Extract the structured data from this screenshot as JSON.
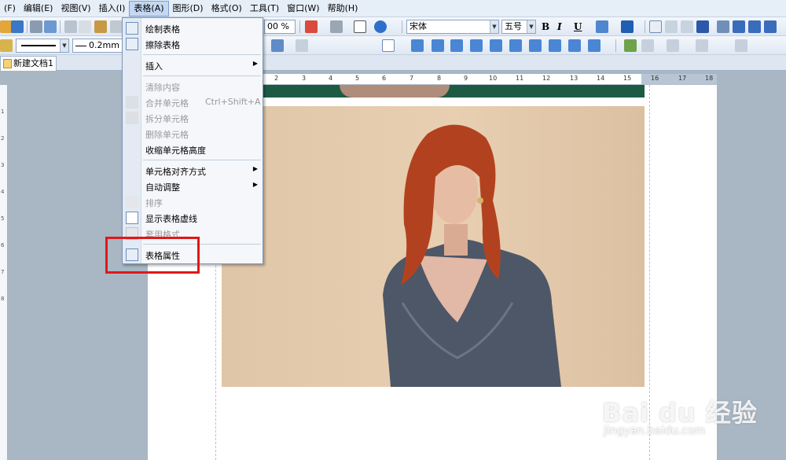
{
  "menubar": {
    "items": [
      "(F)",
      "编辑(E)",
      "视图(V)",
      "插入(I)",
      "表格(A)",
      "图形(D)",
      "格式(O)",
      "工具(T)",
      "窗口(W)",
      "帮助(H)"
    ],
    "active_index": 4
  },
  "toolbar": {
    "zoom": "00 %",
    "font_name": "宋体",
    "font_size": "五号",
    "bold": "B",
    "italic": "I",
    "underline": "U",
    "line_width": "0.2mm"
  },
  "tabs": {
    "document": "新建文档1"
  },
  "ruler": {
    "numbers": [
      "2",
      "3",
      "4",
      "5",
      "6",
      "7",
      "8",
      "9",
      "10",
      "11",
      "12",
      "13",
      "14",
      "15",
      "16",
      "17",
      "18"
    ],
    "vertical_numbers": [
      "1",
      "2",
      "3",
      "4",
      "5",
      "6",
      "7",
      "8"
    ]
  },
  "table_menu": {
    "draw_table": "绘制表格",
    "erase_table": "擦除表格",
    "insert": "插入",
    "clear_content": "清除内容",
    "merge_cells": "合并单元格",
    "merge_shortcut": "Ctrl+Shift+A",
    "split_cells": "拆分单元格",
    "delete_cells": "删除单元格",
    "shrink_height": "收缩单元格高度",
    "cell_align": "单元格对齐方式",
    "auto_adjust": "自动调整",
    "sort": "排序",
    "show_gridlines": "显示表格虚线",
    "apply_format": "套用格式...",
    "table_properties": "表格属性"
  },
  "watermark": {
    "brand": "Bai du 经验",
    "url": "jingyan.baidu.com"
  },
  "colors": {
    "menu_bg": "#e6eef8",
    "highlight_red": "#e01818",
    "photo_bg": "#e4cbad",
    "hair": "#b2421f",
    "dress": "#4d5767"
  }
}
